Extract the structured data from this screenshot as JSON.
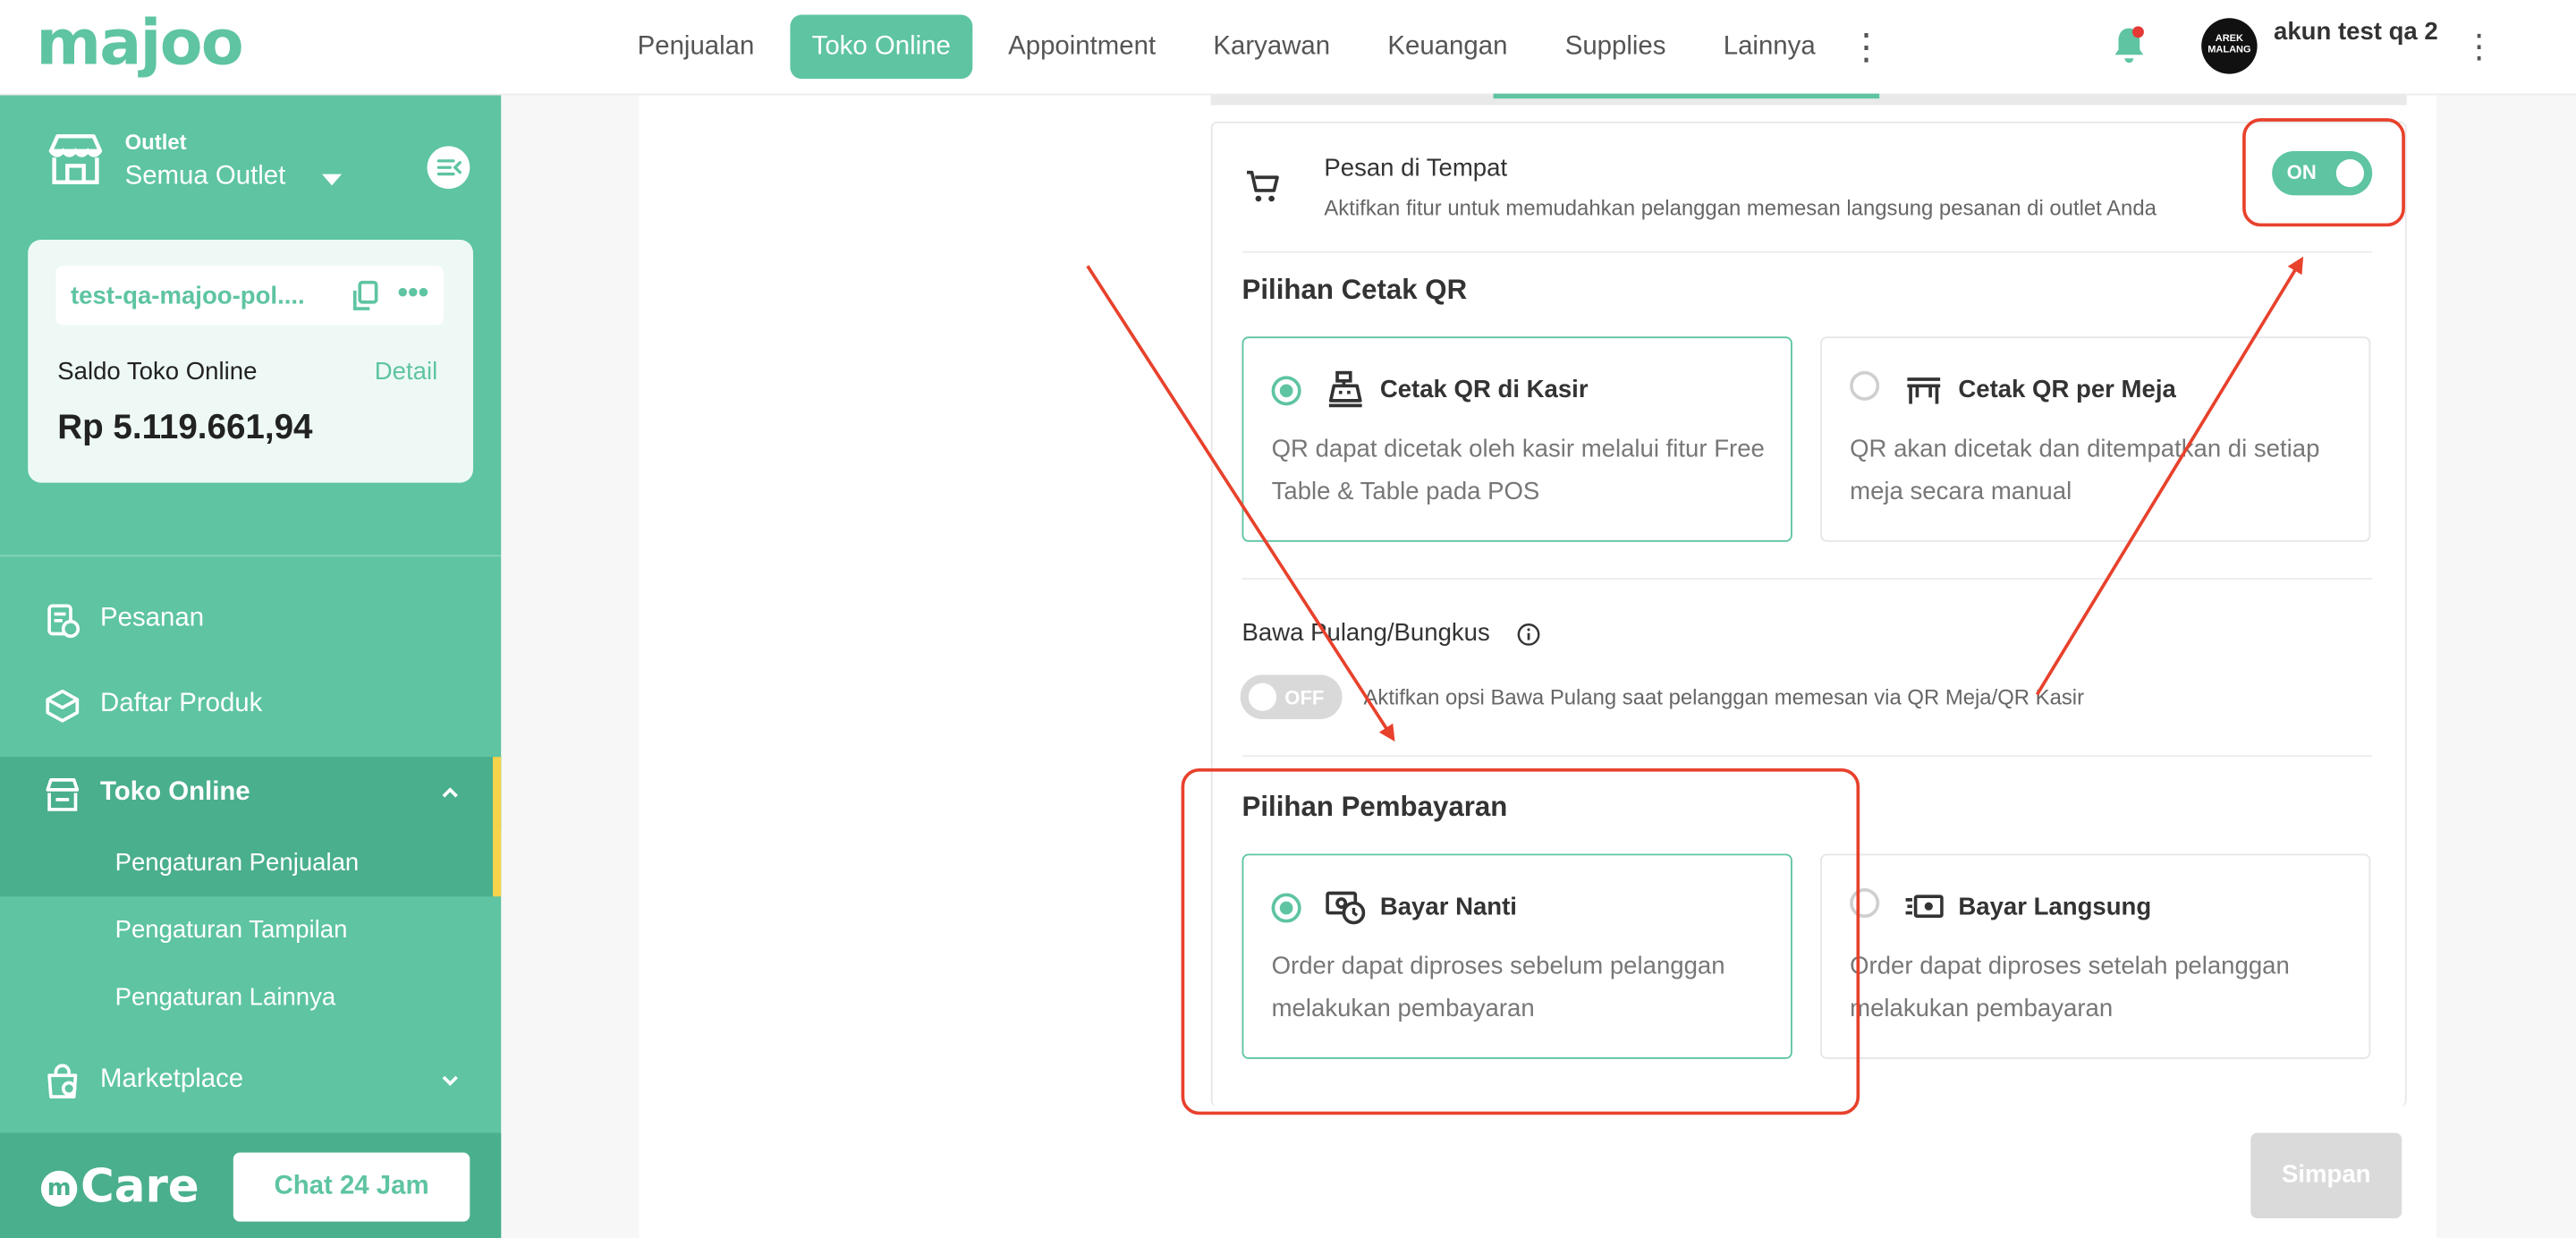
{
  "app": {
    "logo_text": "majoo",
    "brand_color": "#5ec4a1"
  },
  "topnav": {
    "items": [
      {
        "label": "Penjualan",
        "active": false
      },
      {
        "label": "Toko Online",
        "active": true
      },
      {
        "label": "Appointment",
        "active": false
      },
      {
        "label": "Karyawan",
        "active": false
      },
      {
        "label": "Keuangan",
        "active": false
      },
      {
        "label": "Supplies",
        "active": false
      },
      {
        "label": "Lainnya",
        "active": false
      }
    ],
    "more_icon": "vertical-dots-icon"
  },
  "user": {
    "avatar_text": "AREK MALANG",
    "name": "akun test qa 2",
    "has_notification": true
  },
  "sidebar": {
    "outlet_label": "Outlet",
    "outlet_value": "Semua Outlet",
    "store_url": "test-qa-majoo-pol....",
    "saldo_label": "Saldo Toko Online",
    "saldo_detail": "Detail",
    "saldo_value": "Rp 5.119.661,94",
    "menu": [
      {
        "label": "Pesanan",
        "icon": "order-icon"
      },
      {
        "label": "Daftar Produk",
        "icon": "box-icon"
      },
      {
        "label": "Toko Online",
        "icon": "store-icon",
        "expanded": true
      },
      {
        "label": "Marketplace",
        "icon": "marketplace-icon",
        "expanded": false
      }
    ],
    "submenu": [
      {
        "label": "Pengaturan Penjualan",
        "active": true
      },
      {
        "label": "Pengaturan Tampilan",
        "active": false
      },
      {
        "label": "Pengaturan Lainnya",
        "active": false
      }
    ],
    "care_logo": "Care",
    "chat_button": "Chat 24 Jam"
  },
  "main": {
    "feature": {
      "title": "Pesan di Tempat",
      "description": "Aktifkan fitur untuk memudahkan pelanggan memesan langsung pesanan di outlet Anda",
      "toggle_label": "ON",
      "enabled": true
    },
    "qr_section": {
      "title": "Pilihan Cetak QR",
      "options": [
        {
          "title": "Cetak QR di Kasir",
          "description": "QR dapat dicetak oleh kasir melalui fitur Free Table & Table pada POS",
          "selected": true,
          "icon": "cashier-icon"
        },
        {
          "title": "Cetak QR per Meja",
          "description": "QR akan dicetak dan ditempatkan di setiap meja secara manual",
          "selected": false,
          "icon": "table-icon"
        }
      ]
    },
    "takeaway": {
      "label": "Bawa Pulang/Bungkus",
      "toggle_label": "OFF",
      "enabled": false,
      "description": "Aktifkan opsi Bawa Pulang saat pelanggan memesan via QR Meja/QR Kasir"
    },
    "payment_section": {
      "title": "Pilihan Pembayaran",
      "options": [
        {
          "title": "Bayar Nanti",
          "description": "Order dapat diproses sebelum pelanggan melakukan pembayaran",
          "selected": true,
          "icon": "pay-later-icon"
        },
        {
          "title": "Bayar Langsung",
          "description": "Order dapat diproses setelah pelanggan melakukan pembayaran",
          "selected": false,
          "icon": "cash-icon"
        }
      ]
    },
    "save_button": "Simpan"
  },
  "annotation_color": "#e8412c"
}
